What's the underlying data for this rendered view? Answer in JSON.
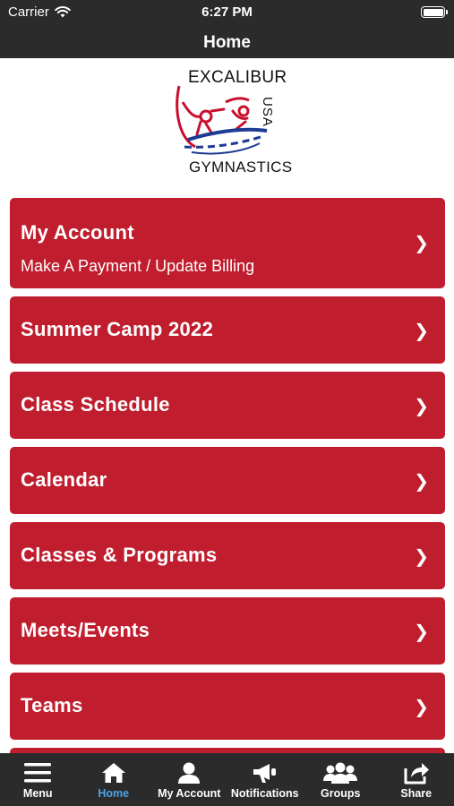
{
  "status_bar": {
    "carrier": "Carrier",
    "time": "6:27 PM",
    "battery_level": 1.0
  },
  "nav_bar": {
    "title": "Home"
  },
  "logo": {
    "line1": "EXCALIBUR",
    "line2": "USA",
    "line3": "GYMNASTICS",
    "colors": {
      "red": "#c8102e",
      "blue": "#1f3a93"
    }
  },
  "menu": {
    "items": [
      {
        "title": "My Account",
        "subtitle": "Make A Payment / Update Billing",
        "chevron": "❯"
      },
      {
        "title": "Summer Camp 2022",
        "chevron": "❯"
      },
      {
        "title": "Class Schedule",
        "chevron": "❯"
      },
      {
        "title": "Calendar",
        "chevron": "❯"
      },
      {
        "title": "Classes & Programs",
        "chevron": "❯"
      },
      {
        "title": "Meets/Events",
        "chevron": "❯"
      },
      {
        "title": "Teams",
        "chevron": "❯"
      },
      {
        "title": "",
        "chevron": ""
      }
    ],
    "color": "#c01e2e"
  },
  "tab_bar": {
    "tabs": [
      {
        "label": "Menu",
        "icon": "hamburger-menu-icon",
        "active": false
      },
      {
        "label": "Home",
        "icon": "home-icon",
        "active": true
      },
      {
        "label": "My Account",
        "icon": "user-icon",
        "active": false
      },
      {
        "label": "Notifications",
        "icon": "megaphone-icon",
        "active": false
      },
      {
        "label": "Groups",
        "icon": "group-icon",
        "active": false
      },
      {
        "label": "Share",
        "icon": "share-icon",
        "active": false
      }
    ],
    "active_color": "#4aa3e6"
  }
}
